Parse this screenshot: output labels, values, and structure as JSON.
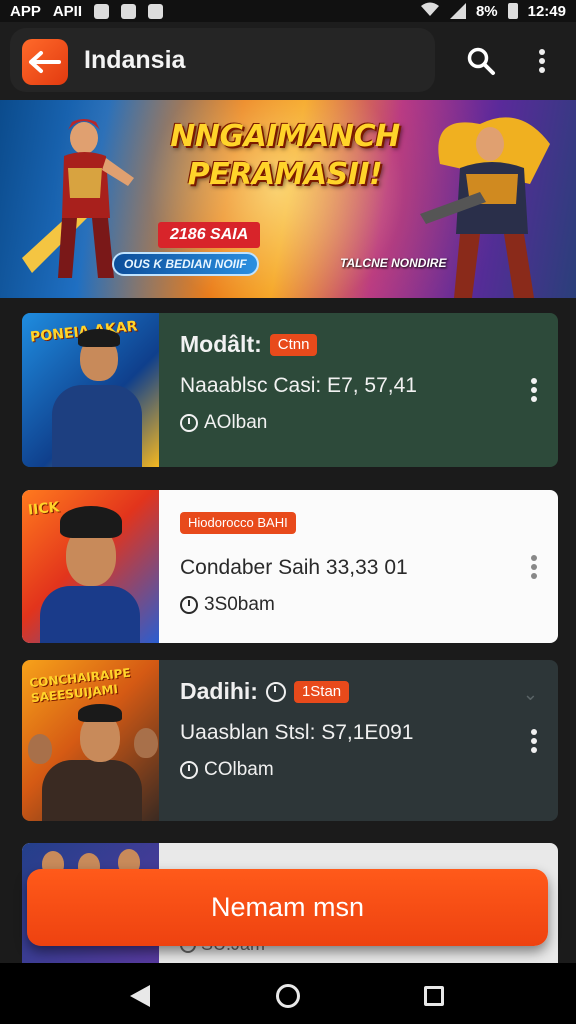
{
  "statusbar": {
    "left_labels": [
      "APP",
      "APII"
    ],
    "battery": "8%",
    "time": "12:49"
  },
  "appbar": {
    "title": "Indansia",
    "logo_icon": "back-arrow-icon",
    "search_icon": "search-icon",
    "more_icon": "more-vert-icon"
  },
  "banner": {
    "headline_line1": "NNGAIMANCH",
    "headline_line2": "PERAMASII!",
    "red_chip": "2186 SAIA",
    "blue_chip": "OUS K BEDIAN NOIIF",
    "tag": "TALCNE NONDIRE"
  },
  "cards": [
    {
      "title": "Modâlt:",
      "badge": "Ctnn",
      "price": "Naaablsc Casi: E7, 57,41",
      "timer": "AOlban",
      "thumb_text": "PONEIA AKAR",
      "bg": "#2d4a3a"
    },
    {
      "title": "",
      "badge": "Hiodorocco   BAHI",
      "price": "Condaber Saih  33,33 01",
      "timer": "3S0bam",
      "thumb_text": "IICK",
      "bg": "#fbfbfb"
    },
    {
      "title": "Dadihi:",
      "badge": "1Stan",
      "price": "Uaasblan Stsl: S7,1E091",
      "timer": "COlbam",
      "thumb_text": "CONCHAIRAIPE SAEESUIJAMI",
      "bg": "#2d3638"
    },
    {
      "title": "",
      "badge": "",
      "price": "",
      "timer": "SU.Jam",
      "thumb_text": "",
      "bg": "#e9e9e9"
    }
  ],
  "cta": {
    "label": "Nemam msn",
    "color": "#ee4a14"
  },
  "navbar": {
    "back_icon": "nav-back-icon",
    "home_icon": "nav-home-icon",
    "recent_icon": "nav-recents-icon"
  }
}
